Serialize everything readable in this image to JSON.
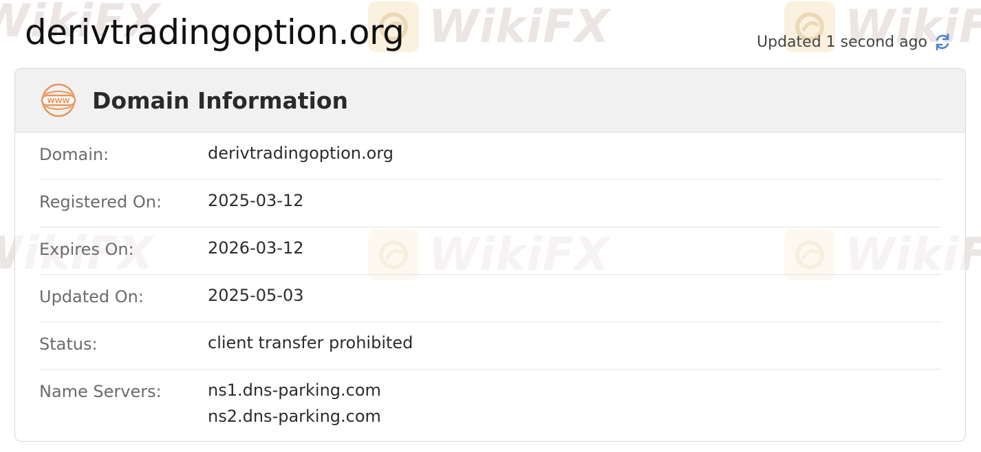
{
  "header": {
    "title": "derivtradingoption.org",
    "updated_text": "Updated 1 second ago"
  },
  "card": {
    "title": "Domain Information",
    "rows": [
      {
        "label": "Domain:",
        "value": "derivtradingoption.org"
      },
      {
        "label": "Registered On:",
        "value": "2025-03-12"
      },
      {
        "label": "Expires On:",
        "value": "2026-03-12"
      },
      {
        "label": "Updated On:",
        "value": "2025-05-03"
      },
      {
        "label": "Status:",
        "value": "client transfer prohibited"
      },
      {
        "label": "Name Servers:",
        "values": [
          "ns1.dns-parking.com",
          "ns2.dns-parking.com"
        ]
      }
    ]
  },
  "watermark": {
    "text": "WikiFX"
  },
  "icons": {
    "header_icon": "www-globe-icon",
    "refresh": "refresh-icon"
  },
  "colors": {
    "accent_orange": "#e8955a",
    "refresh_blue": "#4a7fd4"
  }
}
